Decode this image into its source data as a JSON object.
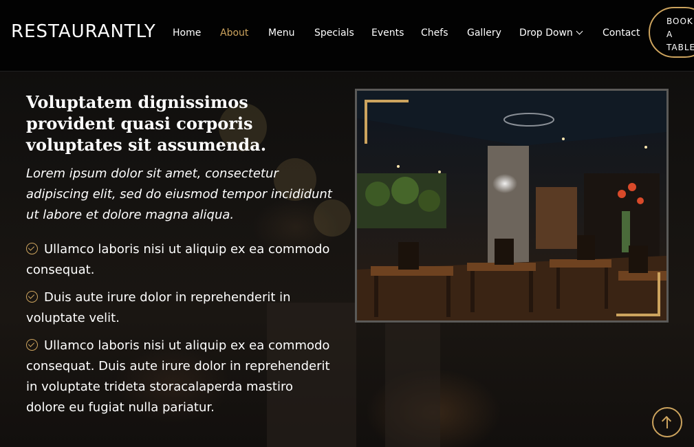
{
  "header": {
    "logo": "RESTAURANTLY",
    "nav": [
      {
        "label": "Home",
        "active": false
      },
      {
        "label": "About",
        "active": true
      },
      {
        "label": "Menu",
        "active": false
      },
      {
        "label": "Specials",
        "active": false
      },
      {
        "label": "Events",
        "active": false
      },
      {
        "label": "Chefs",
        "active": false
      },
      {
        "label": "Gallery",
        "active": false
      },
      {
        "label": "Drop Down",
        "active": false,
        "icon": "chevron-down-icon"
      },
      {
        "label": "Contact",
        "active": false
      }
    ],
    "book_button": [
      "BOOK",
      "A",
      "TABLE"
    ]
  },
  "about": {
    "title": "Voluptatem dignissimos provident quasi corporis voluptates sit assumenda.",
    "lead": "Lorem ipsum dolor sit amet, consectetur adipiscing elit, sed do eiusmod tempor incididunt ut labore et dolore magna aliqua.",
    "items": [
      "Ullamco laboris nisi ut aliquip ex ea commodo consequat.",
      "Duis aute irure dolor in reprehenderit in voluptate velit.",
      "Ullamco laboris nisi ut aliquip ex ea commodo consequat. Duis aute irure dolor in reprehenderit in voluptate trideta storacalaperda mastiro dolore eu fugiat nulla pariatur."
    ],
    "item_icon": "check-circle-icon",
    "image": "restaurant-interior-photo"
  },
  "colors": {
    "accent": "#cda45e",
    "header_bg": "#000000",
    "text": "#ffffff"
  },
  "back_to_top_icon": "arrow-up-icon"
}
